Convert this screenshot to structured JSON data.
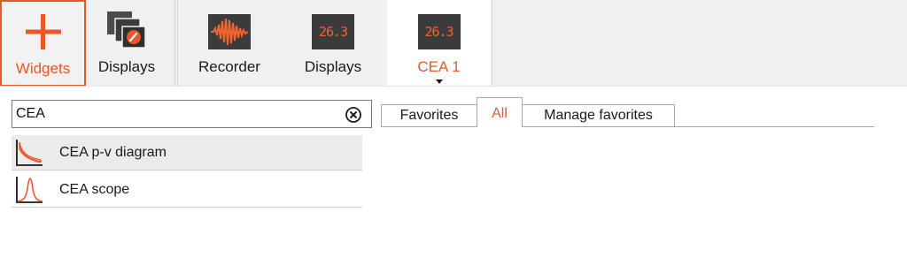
{
  "toolbar": {
    "widgets_label": "Widgets",
    "displays_label": "Displays",
    "recorder_label": "Recorder",
    "displays2_label": "Displays",
    "displays2_value": "26.3",
    "cea1_label": "CEA 1",
    "cea1_value": "26.3",
    "icons": {
      "widgets": "plus-icon",
      "displays": "displays-edit-icon",
      "recorder": "waveform-icon",
      "displays2": "lcd-display-icon",
      "cea1": "lcd-display-icon",
      "cea1_menu": "chevron-down-icon"
    }
  },
  "search": {
    "value": "CEA",
    "placeholder": "",
    "clear_icon": "clear-icon"
  },
  "tabs": [
    {
      "label": "Favorites",
      "active": false
    },
    {
      "label": "All",
      "active": true
    },
    {
      "label": "Manage favorites",
      "active": false
    }
  ],
  "results": [
    {
      "label": "CEA p-v diagram",
      "icon": "pv-diagram-icon",
      "selected": true
    },
    {
      "label": "CEA scope",
      "icon": "scope-icon",
      "selected": false
    }
  ],
  "colors": {
    "accent": "#e8572a",
    "lcd_background": "#3b3b3b",
    "lcd_digits": "#f26430",
    "toolbar_background": "#f0f0f0"
  }
}
